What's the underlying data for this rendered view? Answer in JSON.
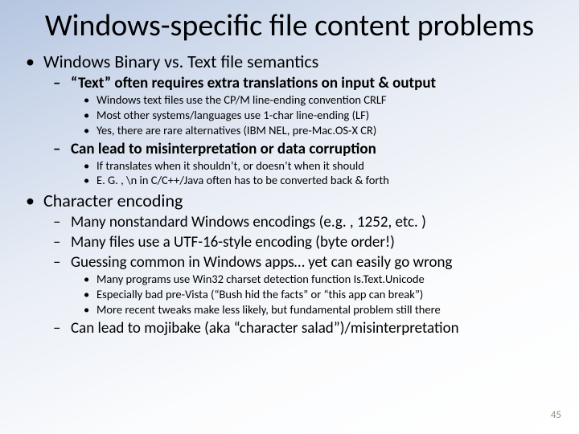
{
  "title": "Windows-specific file content problems",
  "bullets": {
    "b1": "Windows Binary vs. Text file semantics",
    "b1_1": "“Text” often requires extra translations on input & output",
    "b1_1_1": "Windows text files use the CP/M line-ending convention CRLF",
    "b1_1_2": "Most other systems/languages use 1-char line-ending (LF)",
    "b1_1_3": "Yes, there are rare alternatives (IBM NEL, pre-Mac.OS-X CR)",
    "b1_2": "Can lead to misinterpretation or data corruption",
    "b1_2_1": "If translates when it shouldn’t, or doesn’t when it should",
    "b1_2_2": "E. G. , \\n in C/C++/Java often has to be converted back & forth",
    "b2": "Character encoding",
    "b2_1": "Many nonstandard Windows encodings (e.g. , 1252, etc. )",
    "b2_2": "Many files use a UTF-16-style encoding (byte order!)",
    "b2_3": "Guessing common in Windows apps… yet can easily go wrong",
    "b2_3_1": "Many programs use Win32 charset detection function Is.Text.Unicode",
    "b2_3_2": "Especially bad pre-Vista (“Bush hid the facts” or “this app can break”)",
    "b2_3_3": "More recent tweaks make less likely, but fundamental problem still there",
    "b2_4": "Can lead to mojibake (aka “character salad”)/misinterpretation"
  },
  "page_number": "45"
}
